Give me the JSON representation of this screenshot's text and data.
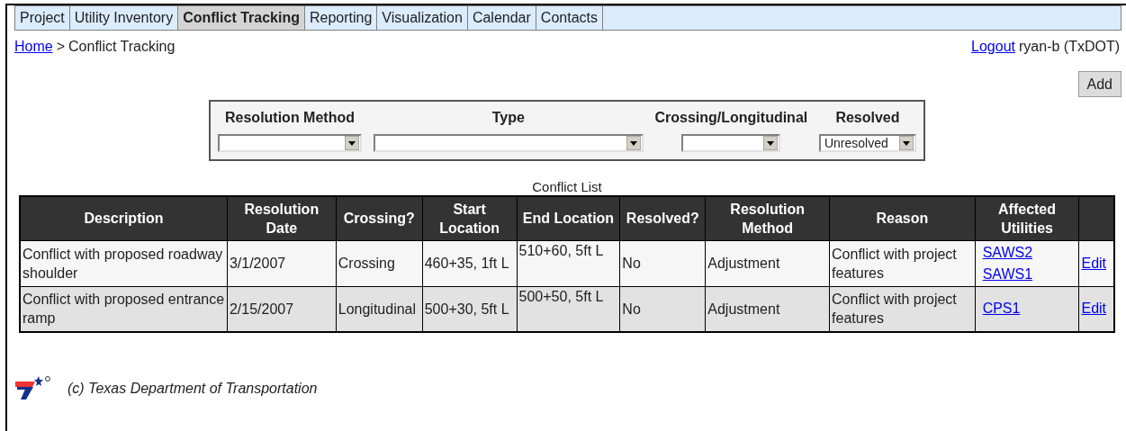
{
  "tabs": [
    {
      "label": "Project",
      "selected": false
    },
    {
      "label": "Utility Inventory",
      "selected": false
    },
    {
      "label": "Conflict Tracking",
      "selected": true
    },
    {
      "label": "Reporting",
      "selected": false
    },
    {
      "label": "Visualization",
      "selected": false
    },
    {
      "label": "Calendar",
      "selected": false
    },
    {
      "label": "Contacts",
      "selected": false
    }
  ],
  "breadcrumb": {
    "link": "Home",
    "separator": ">",
    "current": "Conflict Tracking"
  },
  "user": {
    "logout": "Logout",
    "name": "ryan-b (TxDOT)"
  },
  "add_button": "Add",
  "filters": [
    {
      "label": "Resolution Method"
    },
    {
      "label": "Type"
    },
    {
      "label": "Crossing/Longitudinal"
    },
    {
      "label": "Resolved",
      "value": "Unresolved"
    }
  ],
  "table": {
    "caption": "Conflict List",
    "columns": [
      "Description",
      "Resolution Date",
      "Crossing?",
      "Start Location",
      "End Location",
      "Resolved?",
      "Resolution Method",
      "Reason",
      "Affected Utilities"
    ],
    "rows": [
      {
        "cells": [
          "Conflict with proposed roadway shoulder",
          "3/1/2007",
          "Crossing",
          "460+35, 1ft L",
          "510+60, 5ft L",
          "No",
          "Adjustment",
          "Conflict with project features"
        ],
        "utilities": [
          "SAWS2",
          "SAWS1"
        ],
        "action": "Edit"
      },
      {
        "cells": [
          "Conflict with proposed entrance ramp",
          "2/15/2007",
          "Longitudinal",
          "500+30, 5ft L",
          "500+50, 5ft L",
          "No",
          "Adjustment",
          "Conflict with project features"
        ],
        "utilities": [
          "CPS1"
        ],
        "action": "Edit"
      }
    ]
  },
  "footer": "(c) Texas Department of Transportation"
}
